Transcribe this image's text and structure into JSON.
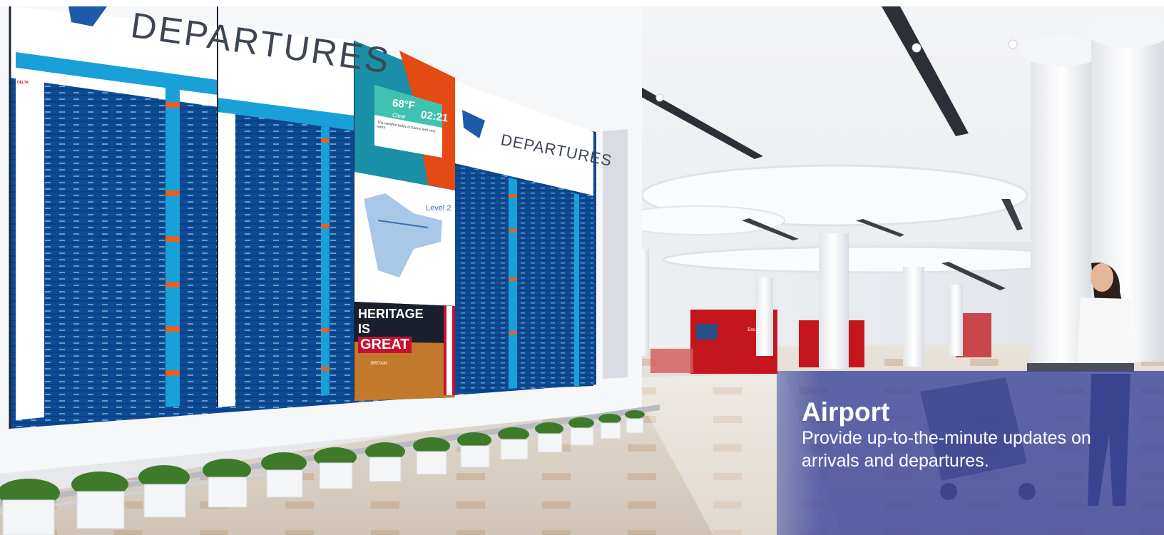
{
  "caption": {
    "title": "Airport",
    "text": "Provide up-to-the-minute updates on arrivals and departures."
  },
  "photo": {
    "board_large_heading": "DEPARTURES",
    "board_small_heading": "DEPARTURES",
    "weather_temp": "68°F",
    "weather_condition": "Clear",
    "weather_time": "02:21",
    "weather_message": "The weather today is Sunny and very warm",
    "map_level": "Level 2",
    "ad_line1": "HERITAGE",
    "ad_line2": "IS",
    "ad_line3": "GREAT",
    "ad_line4": "BRITAIN",
    "airline_label": "DELTA",
    "kiosk_brand": "Emirates",
    "colors": {
      "board_blue": "#0d4a94",
      "board_cyan": "#1aa0d8",
      "status_orange": "#e0622a",
      "kiosk_red": "#c4161c",
      "caption_blue": "#3e4a9e"
    }
  }
}
